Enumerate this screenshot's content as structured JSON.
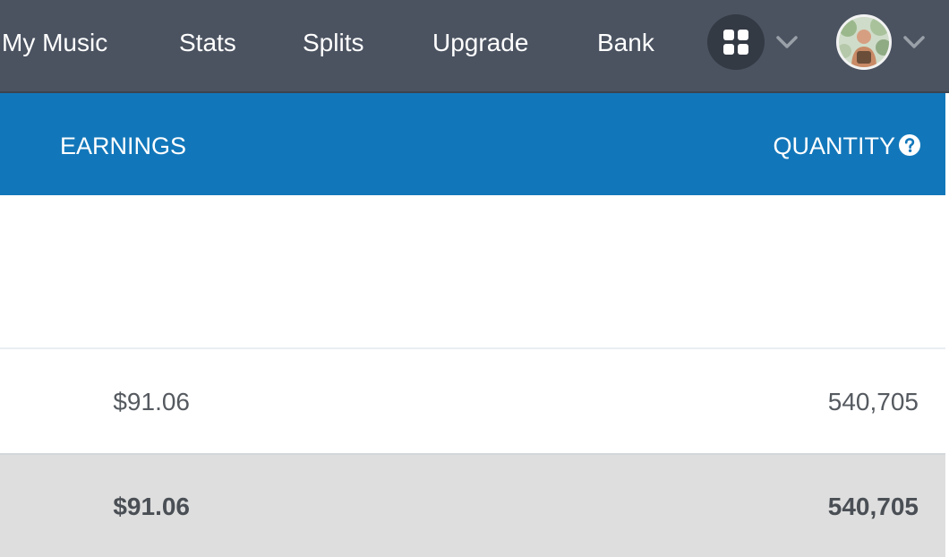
{
  "nav": {
    "links": [
      "My Music",
      "Stats",
      "Splits",
      "Upgrade",
      "Bank"
    ],
    "apps_icon": "apps-grid-icon",
    "dropdown_icon": "chevron-down-icon",
    "avatar_icon": "user-avatar"
  },
  "table": {
    "headers": {
      "earnings": "EARNINGS",
      "quantity": "QUANTITY"
    },
    "help_icon": "question-circle-icon",
    "rows": [
      {
        "earnings": "$91.06",
        "quantity": "540,705"
      }
    ],
    "total": {
      "earnings": "$91.06",
      "quantity": "540,705"
    }
  },
  "colors": {
    "nav_bg": "#4b5361",
    "header_bg": "#1277ba",
    "total_row_bg": "#dedede",
    "text": "#555a60"
  }
}
